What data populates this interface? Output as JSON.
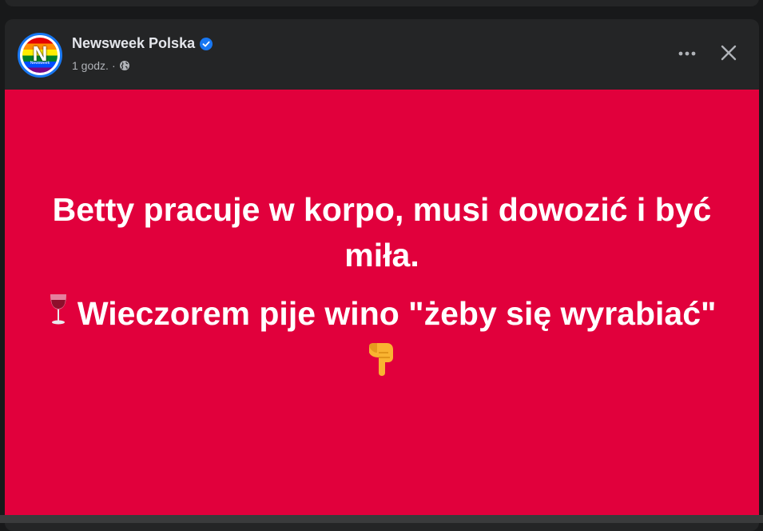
{
  "post": {
    "page_name": "Newsweek Polska",
    "time": "1 godz.",
    "separator": "·",
    "avatar_letter": "N",
    "avatar_sub": "Newsweek",
    "icons": {
      "verified": "verified-badge-icon",
      "audience": "globe-icon",
      "more": "more-options-icon",
      "close": "close-icon",
      "wine": "wine-glass-emoji",
      "pointing": "pointing-down-emoji"
    },
    "colors": {
      "background": "#e1003c",
      "verified": "#1877f2",
      "text": "#ffffff"
    },
    "content": {
      "line1": "Betty pracuje w korpo, musi dowozić i być miła.",
      "line2_text": " Wieczorem pije wino \"żeby się wyrabiać\""
    }
  }
}
